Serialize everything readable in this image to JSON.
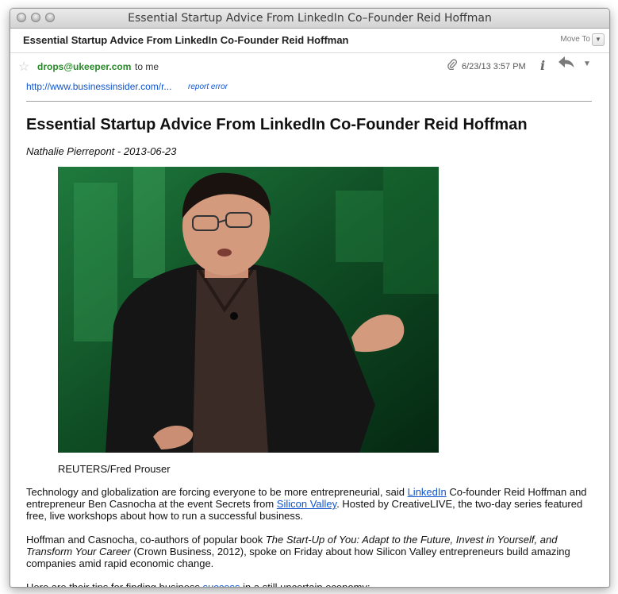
{
  "window": {
    "title": "Essential Startup Advice From LinkedIn Co–Founder Reid Hoffman"
  },
  "header": {
    "subject": "Essential Startup Advice From LinkedIn Co-Founder Reid Hoffman",
    "move_to_label": "Move To",
    "move_to_icon": "chevron-down-icon"
  },
  "message": {
    "sender": "drops@ukeeper.com",
    "recipient": "to me",
    "date": "6/23/13 3:57 PM",
    "source_link": "http://www.businessinsider.com/r...",
    "report_label": "report error"
  },
  "article": {
    "headline": "Essential Startup Advice From LinkedIn Co-Founder Reid Hoffman",
    "byline": "Nathalie Pierrepont - 2013-06-23",
    "caption": "REUTERS/Fred Prouser",
    "p1": {
      "t1": "Technology and globalization are forcing everyone to be more entrepreneurial, said ",
      "link1": "LinkedIn",
      "t2": " Co-founder Reid Hoffman and entrepreneur Ben Casnocha at the event Secrets from ",
      "link2": "Silicon Valley",
      "t3": ". Hosted by CreativeLIVE, the two-day series featured free, live workshops about how to run a successful business."
    },
    "p2": {
      "t1": "Hoffman and Casnocha, co-authors of popular book ",
      "book": "The Start-Up of You: Adapt to the Future, Invest in Yourself, and Transform Your Career",
      "t2": " (Crown Business, 2012), spoke on Friday about how Silicon Valley entrepreneurs build amazing companies amid rapid economic change."
    },
    "p3": {
      "t1": "Here are their tips for finding business ",
      "link1": "success",
      "t2": " in a still uncertain economy:"
    }
  },
  "colors": {
    "sender": "#2a8a2a",
    "link": "#1155cc",
    "photo_background": "#07361a"
  }
}
